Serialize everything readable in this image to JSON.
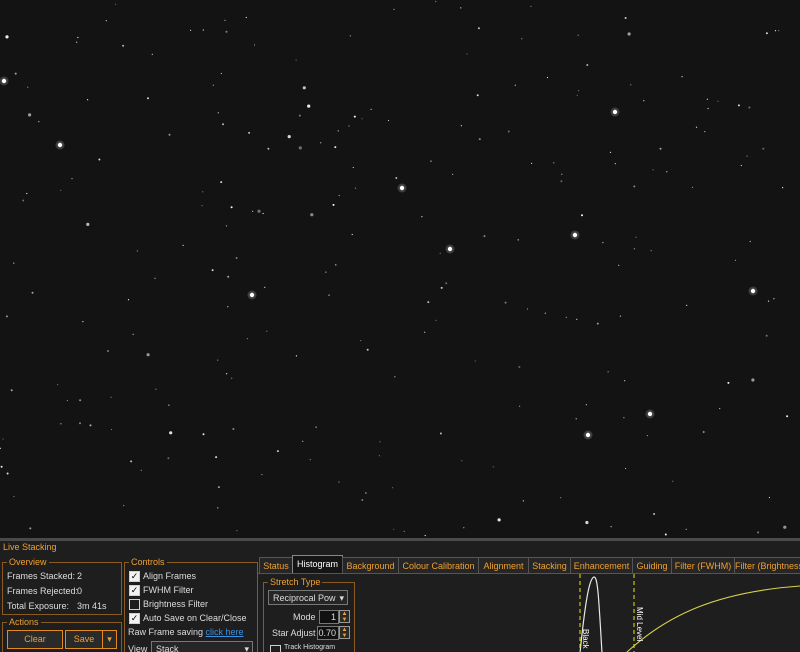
{
  "panel": {
    "title": "Live Stacking"
  },
  "overview": {
    "label": "Overview",
    "frames_stacked_label": "Frames Stacked:",
    "frames_stacked_value": "2",
    "frames_rejected_label": "Frames Rejected:",
    "frames_rejected_value": "0",
    "total_exposure_label": "Total Exposure:",
    "total_exposure_value": "3m 41s"
  },
  "actions": {
    "label": "Actions",
    "clear_label": "Clear",
    "save_label": "Save"
  },
  "controls": {
    "label": "Controls",
    "align_frames": "Align Frames",
    "align_frames_checked": true,
    "fwhm_filter": "FWHM Filter",
    "fwhm_filter_checked": true,
    "brightness_filter": "Brightness Filter",
    "brightness_filter_checked": false,
    "auto_save": "Auto Save on Clear/Close",
    "auto_save_checked": true,
    "raw_saving_label": "Raw Frame saving",
    "raw_saving_link": "click here",
    "view_label": "View",
    "view_value": "Stack"
  },
  "tabs": [
    "Status",
    "Histogram",
    "Background",
    "Colour Calibration",
    "Alignment",
    "Stacking",
    "Enhancement",
    "Guiding",
    "Filter (FWHM)",
    "Filter (Brightness)"
  ],
  "active_tab": "Histogram",
  "histogram": {
    "stretch_type_label": "Stretch Type",
    "stretch_type_value": "Reciprocal Pow",
    "mode_label": "Mode",
    "mode_value": "1",
    "star_adjust_label": "Star Adjust",
    "star_adjust_value": "0.70",
    "track_histogram_label": "Track Histogram",
    "black_label": "Black",
    "mid_level_label": "Mid Level"
  },
  "colors": {
    "accent": "#f0a030",
    "link": "#3b8fe0",
    "marker": "#e6e600"
  }
}
